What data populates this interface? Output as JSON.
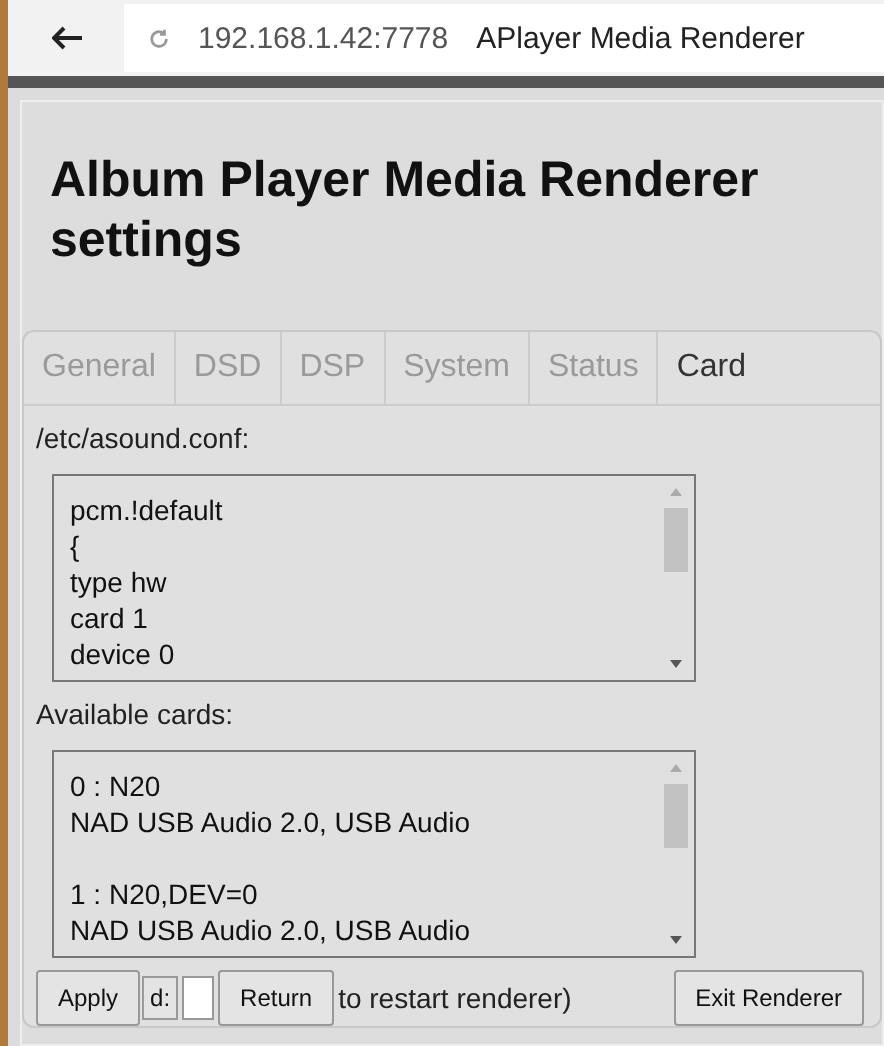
{
  "browser": {
    "address": "192.168.1.42:7778",
    "page_title": "APlayer Media Renderer"
  },
  "title": "Album Player Media Renderer settings",
  "tabs": [
    {
      "label": "General",
      "selected": false
    },
    {
      "label": "DSD",
      "selected": false
    },
    {
      "label": "DSP",
      "selected": false
    },
    {
      "label": "System",
      "selected": false
    },
    {
      "label": "Status",
      "selected": false
    },
    {
      "label": "Card",
      "selected": true
    }
  ],
  "config": {
    "label": "/etc/asound.conf:",
    "value": "pcm.!default\n{\ntype hw\ncard 1\ndevice 0"
  },
  "cards": {
    "label": "Available cards:",
    "value": "0 : N20\nNAD USB Audio 2.0, USB Audio\n\n1 : N20,DEV=0\nNAD USB Audio 2.0, USB Audio"
  },
  "footer": {
    "apply": "Apply",
    "hidden_button": "d:",
    "return": "Return",
    "note": "to restart renderer)",
    "exit": "Exit Renderer"
  }
}
